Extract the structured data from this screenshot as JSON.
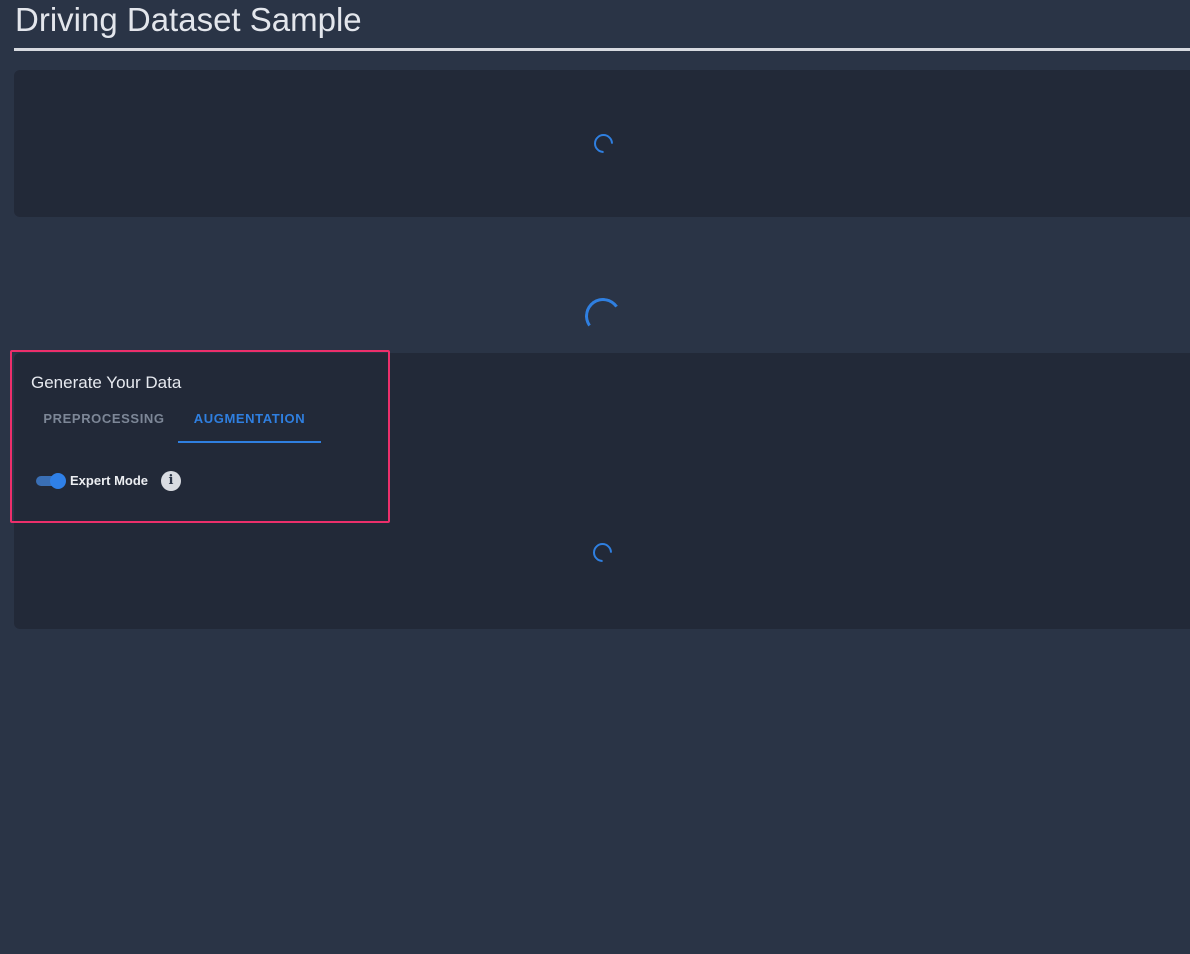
{
  "page": {
    "title": "Driving Dataset Sample"
  },
  "generator": {
    "title": "Generate Your Data",
    "tabs": [
      {
        "label": "PREPROCESSING",
        "active": false
      },
      {
        "label": "AUGMENTATION",
        "active": true
      }
    ],
    "expert_mode": {
      "label": "Expert Mode",
      "enabled": true
    },
    "info_icon": "i"
  },
  "colors": {
    "background": "#2a3446",
    "panel": "#222938",
    "accent": "#2f7fe0",
    "highlight": "#ec2f6b"
  },
  "icons": {
    "spinner": "loading-spinner-icon",
    "info": "info-icon"
  }
}
